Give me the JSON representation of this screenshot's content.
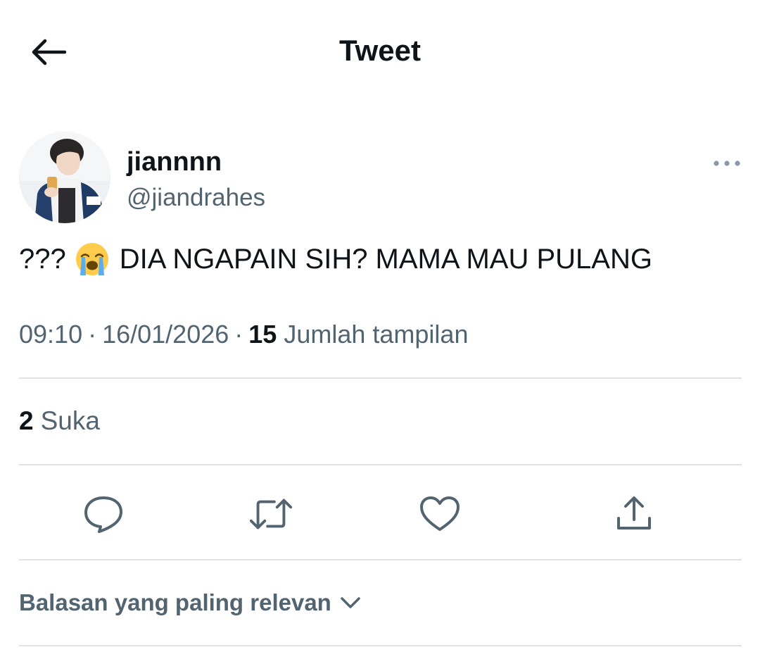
{
  "header": {
    "title": "Tweet",
    "back_icon": "arrow-left-icon"
  },
  "tweet": {
    "author": {
      "display_name": "jiannnn",
      "handle": "@jiandrahes"
    },
    "text_prefix": "???",
    "emoji": "loudly-crying-face",
    "text_suffix": "DIA NGAPAIN SIH? MAMA MAU PULANG",
    "time": "09:10",
    "date": "16/01/2026",
    "separator": "·",
    "views_count": "15",
    "views_label": "Jumlah tampilan",
    "likes_count": "2",
    "likes_label": "Suka"
  },
  "actions": {
    "reply_icon": "reply-icon",
    "retweet_icon": "retweet-icon",
    "like_icon": "heart-icon",
    "share_icon": "share-icon"
  },
  "replies": {
    "sort_label": "Balasan yang paling relevan"
  },
  "colors": {
    "primary_text": "#0f1419",
    "secondary_text": "#536471",
    "divider": "#dfe3e6"
  }
}
